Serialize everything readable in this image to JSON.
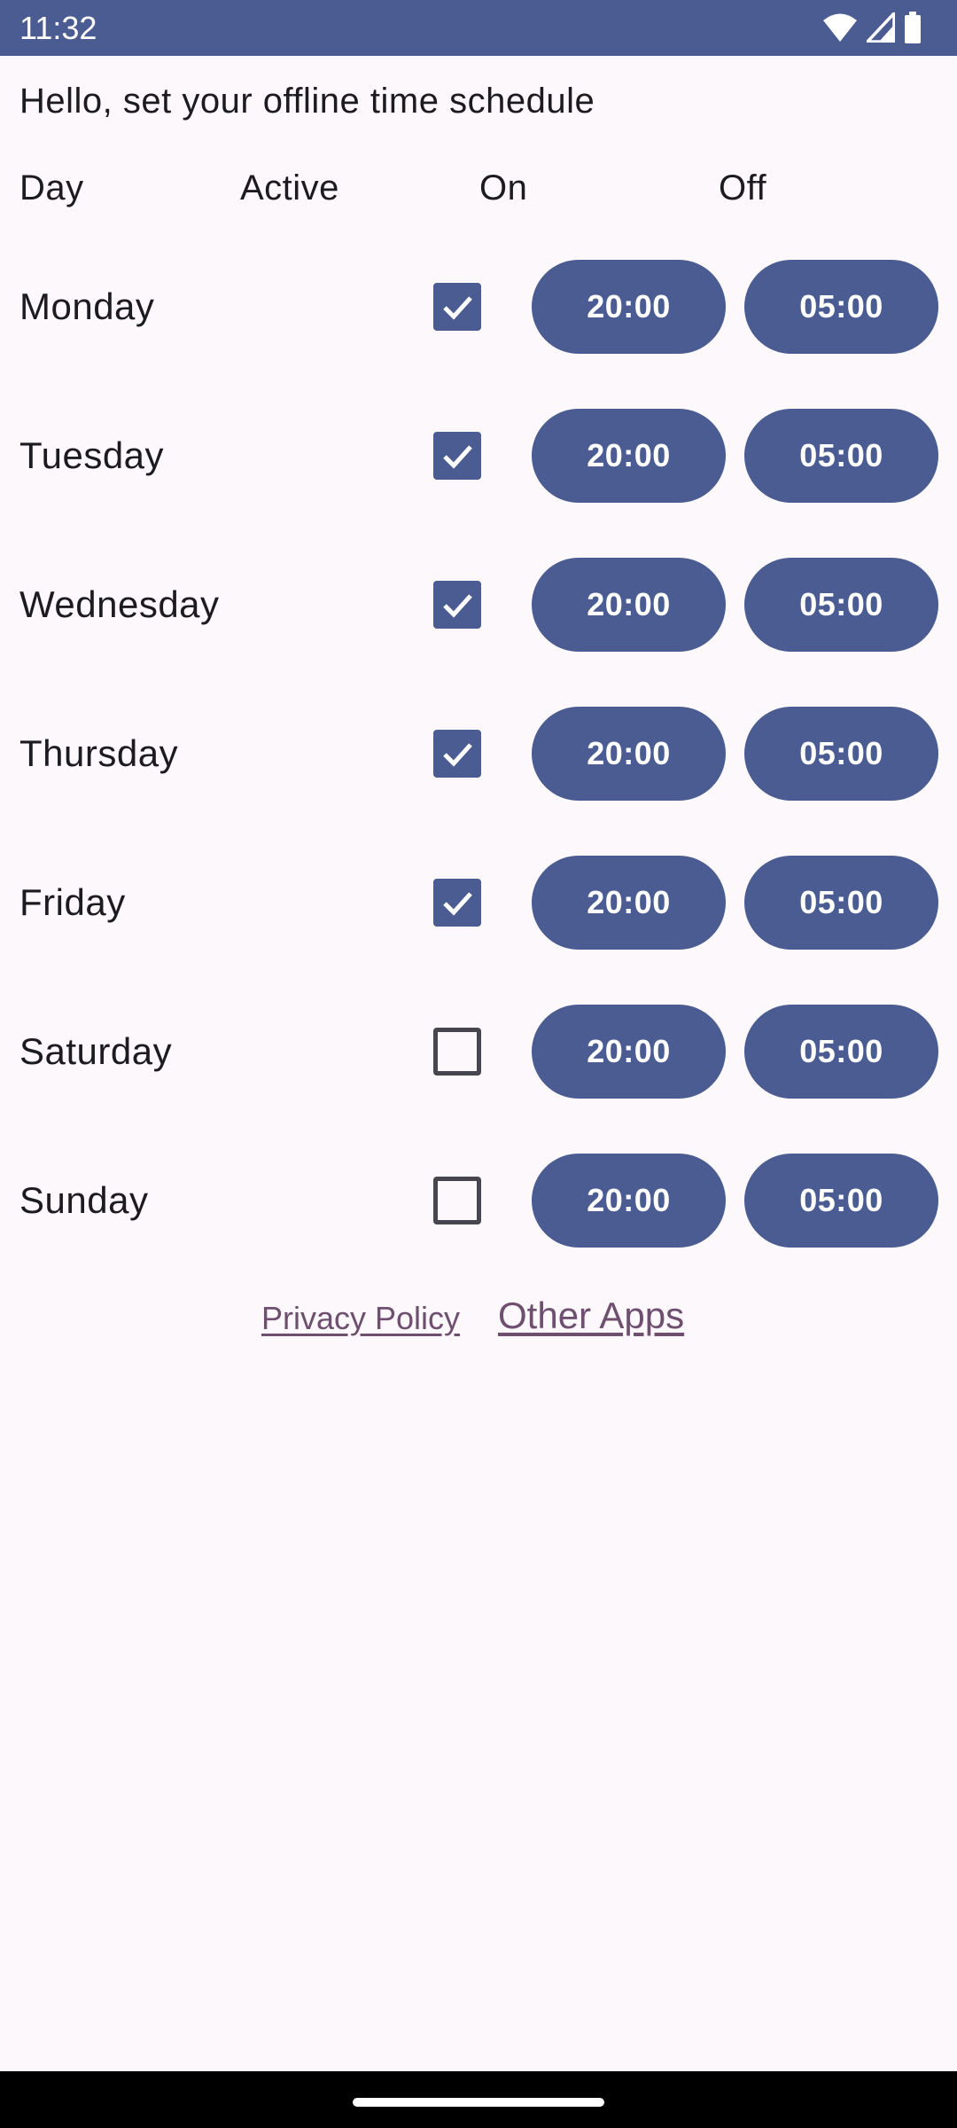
{
  "status_bar": {
    "time": "11:32",
    "icons": [
      "wifi-icon",
      "cell-signal-icon",
      "battery-icon"
    ],
    "background": "#4a5c92"
  },
  "header": {
    "greeting": "Hello, set your offline time schedule"
  },
  "columns": {
    "day": "Day",
    "active": "Active",
    "on": "On",
    "off": "Off"
  },
  "days": [
    {
      "name": "Monday",
      "active": true,
      "on": "20:00",
      "off": "05:00"
    },
    {
      "name": "Tuesday",
      "active": true,
      "on": "20:00",
      "off": "05:00"
    },
    {
      "name": "Wednesday",
      "active": true,
      "on": "20:00",
      "off": "05:00"
    },
    {
      "name": "Thursday",
      "active": true,
      "on": "20:00",
      "off": "05:00"
    },
    {
      "name": "Friday",
      "active": true,
      "on": "20:00",
      "off": "05:00"
    },
    {
      "name": "Saturday",
      "active": false,
      "on": "20:00",
      "off": "05:00"
    },
    {
      "name": "Sunday",
      "active": false,
      "on": "20:00",
      "off": "05:00"
    }
  ],
  "footer_links": {
    "privacy_policy": "Privacy Policy",
    "other_apps": "Other Apps"
  },
  "colors": {
    "accent": "#4a5c92",
    "background": "#fdf8fc",
    "link": "#6f4f6f"
  }
}
